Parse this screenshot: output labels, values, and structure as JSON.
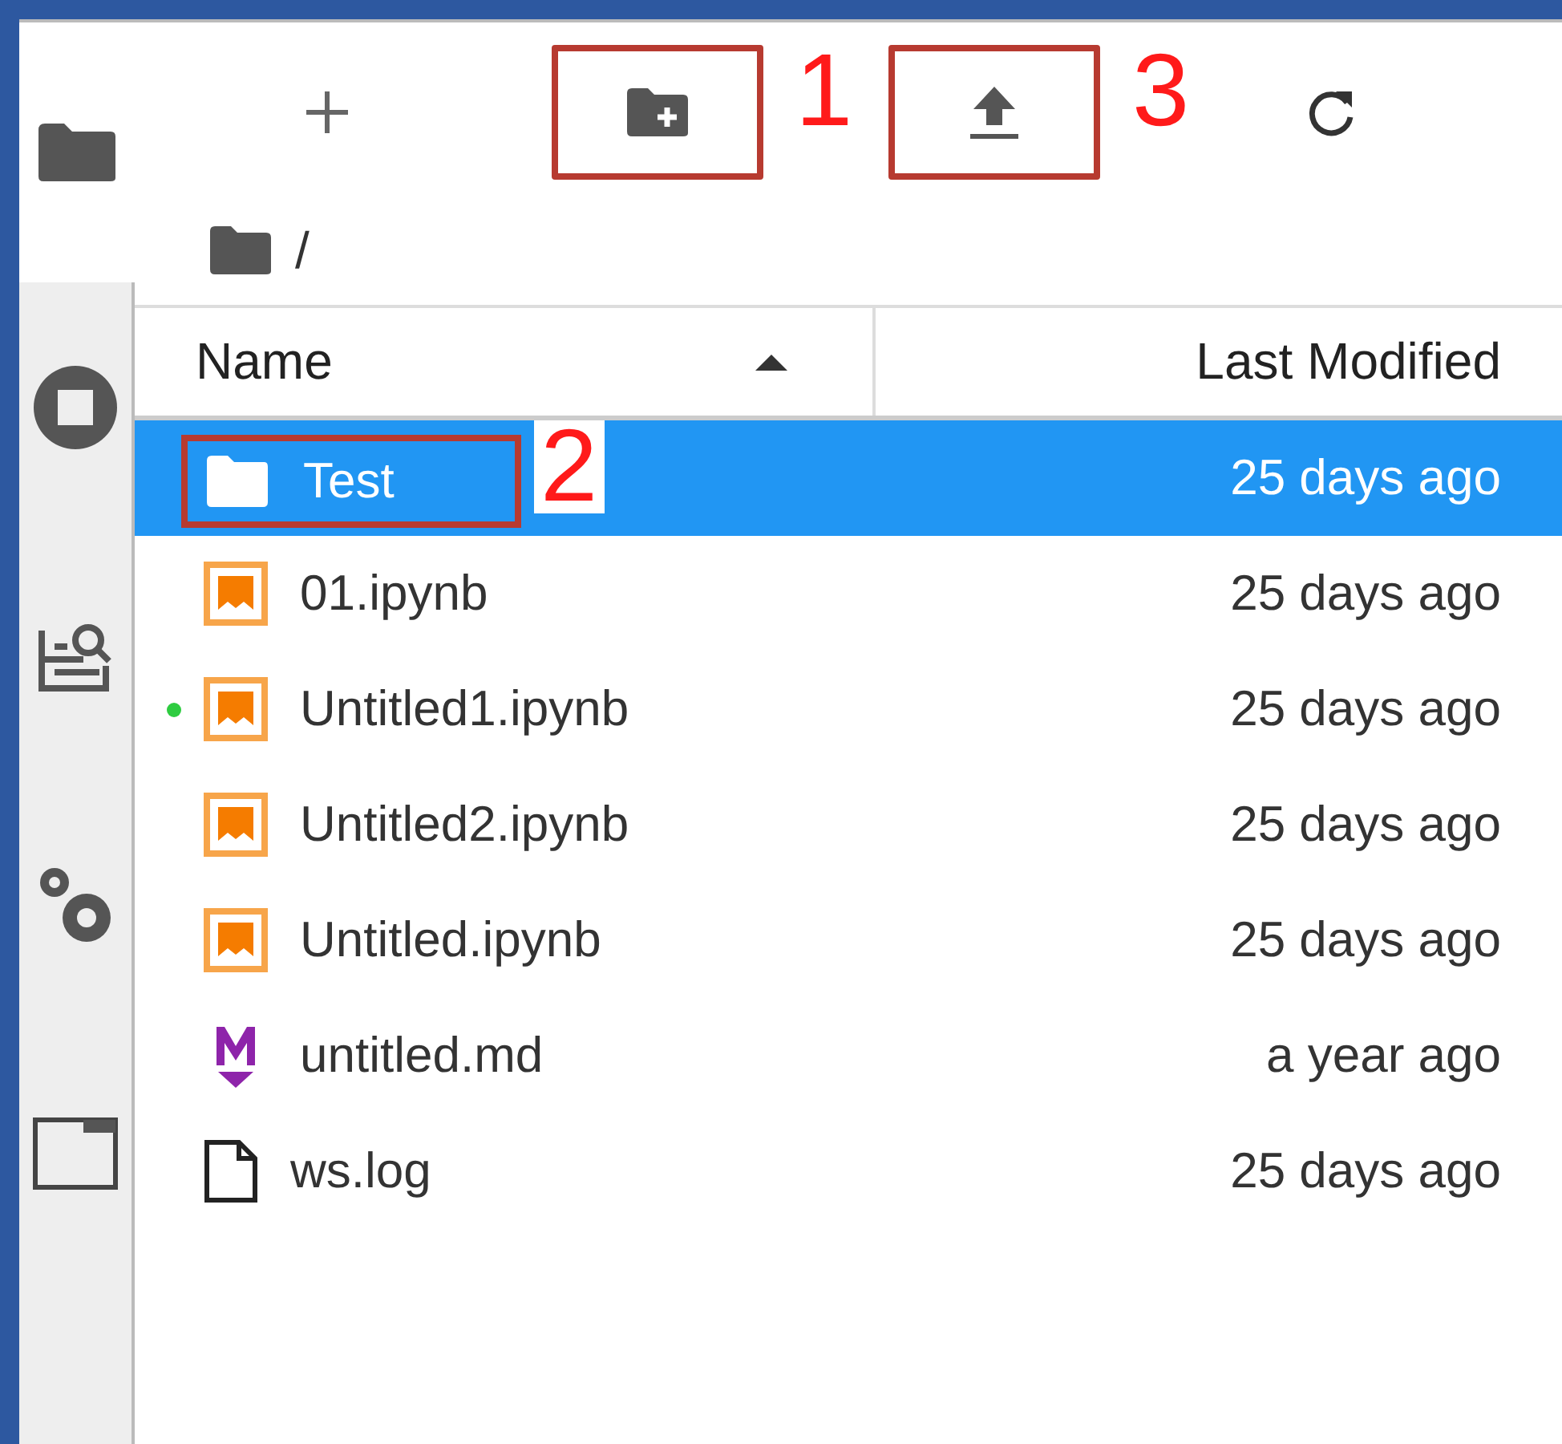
{
  "sidebar": {
    "tabs": [
      {
        "kind": "folder",
        "selected": true
      },
      {
        "kind": "running",
        "selected": false
      },
      {
        "kind": "commands",
        "selected": false
      },
      {
        "kind": "settings",
        "selected": false
      },
      {
        "kind": "tabs",
        "selected": false
      }
    ]
  },
  "toolbar": {
    "buttons": [
      {
        "kind": "new"
      },
      {
        "kind": "new-folder",
        "annotation": "1"
      },
      {
        "kind": "upload",
        "annotation": "3"
      },
      {
        "kind": "refresh"
      }
    ]
  },
  "breadcrumb": {
    "path": "/"
  },
  "table": {
    "columns": [
      {
        "label": "Name",
        "sorted": true
      },
      {
        "label": "Last Modified",
        "sorted": false
      }
    ],
    "rows": [
      {
        "kind": "folder",
        "name": "Test",
        "modified": "25 days ago",
        "selected": true,
        "running": false,
        "annotation": "2"
      },
      {
        "kind": "notebook",
        "name": "01.ipynb",
        "modified": "25 days ago",
        "selected": false,
        "running": false
      },
      {
        "kind": "notebook",
        "name": "Untitled1.ipynb",
        "modified": "25 days ago",
        "selected": false,
        "running": true
      },
      {
        "kind": "notebook",
        "name": "Untitled2.ipynb",
        "modified": "25 days ago",
        "selected": false,
        "running": false
      },
      {
        "kind": "notebook",
        "name": "Untitled.ipynb",
        "modified": "25 days ago",
        "selected": false,
        "running": false
      },
      {
        "kind": "markdown",
        "name": "untitled.md",
        "modified": "a year ago",
        "selected": false,
        "running": false
      },
      {
        "kind": "file",
        "name": "ws.log",
        "modified": "25 days ago",
        "selected": false,
        "running": false
      }
    ]
  }
}
